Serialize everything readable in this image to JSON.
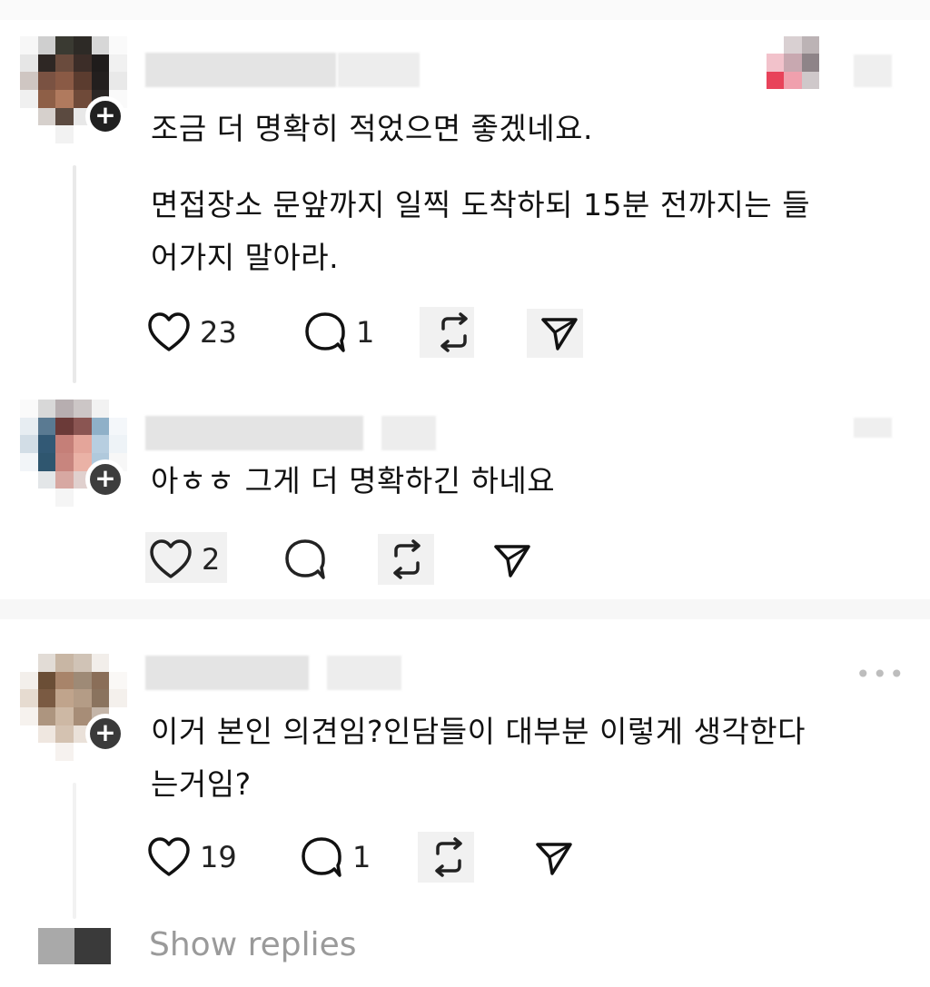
{
  "comments": [
    {
      "text_line1": "조금 더 명확히 적었으면 좋겠네요.",
      "text_line2": "면접장소 문앞까지 일찍 도착하되 15분 전까지는 들",
      "text_line3": "어가지 말아라.",
      "likes": "23",
      "replies": "1"
    },
    {
      "text_line1": "아ㅎㅎ 그게 더 명확하긴 하네요",
      "likes": "2"
    },
    {
      "text_line1": "이거 본인 의견임?인담들이 대부분 이렇게 생각한다",
      "text_line2": "는거임?",
      "likes": "19",
      "replies": "1",
      "more": "•••"
    }
  ],
  "show_replies_label": "Show replies",
  "icons": [
    "heart-icon",
    "comment-icon",
    "repost-icon",
    "share-icon",
    "plus-icon",
    "more-icon"
  ],
  "colors": {
    "text": "#111111",
    "muted": "#9a9a9a",
    "accent": "#e8435a"
  }
}
